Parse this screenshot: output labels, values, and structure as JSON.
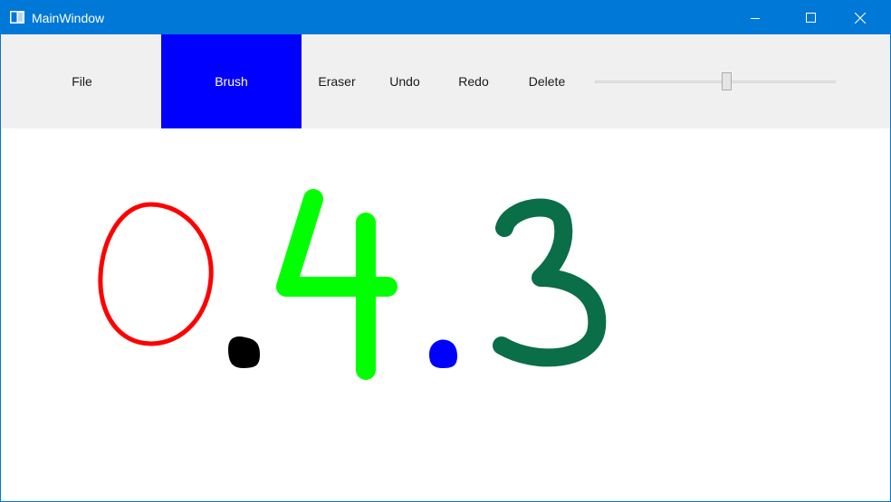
{
  "window": {
    "title": "MainWindow",
    "accent_color": "#0078d7",
    "icons": {
      "app": "window-app-icon",
      "minimize": "minimize-icon",
      "maximize": "maximize-icon",
      "close": "close-icon"
    }
  },
  "toolbar": {
    "file_label": "File",
    "brush_label": "Brush",
    "eraser_label": "Eraser",
    "undo_label": "Undo",
    "redo_label": "Redo",
    "delete_label": "Delete",
    "active_tool": "Brush",
    "active_color": "#0000ff",
    "brush_size_fraction": 0.55
  },
  "canvas": {
    "background": "#ffffff",
    "strokes": [
      {
        "name": "stroke-zero",
        "color": "#ff0000"
      },
      {
        "name": "stroke-dot-black",
        "color": "#000000"
      },
      {
        "name": "stroke-four",
        "color": "#00ff00"
      },
      {
        "name": "stroke-dot-blue",
        "color": "#0000ff"
      },
      {
        "name": "stroke-three",
        "color": "#0a6e48"
      }
    ]
  }
}
